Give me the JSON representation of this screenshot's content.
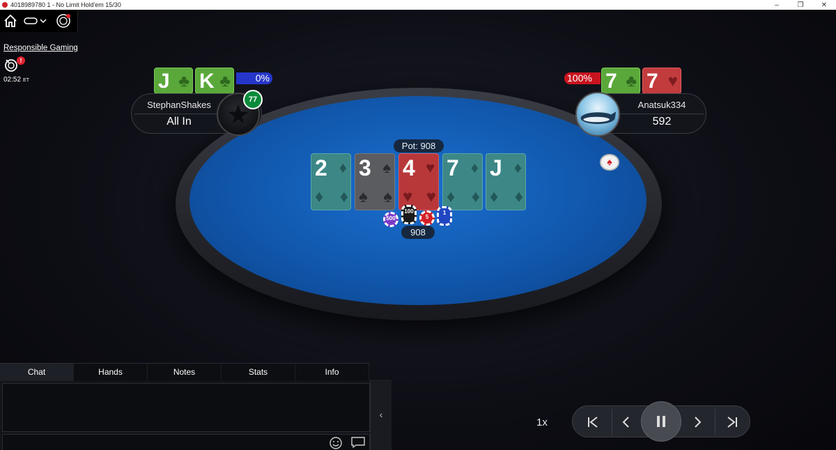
{
  "window": {
    "title": "4018989780 1 - No Limit Hold'em 15/30",
    "minimize": "–",
    "restore": "❐",
    "close": "✕"
  },
  "sidebar": {
    "responsible_gaming": "Responsible Gaming",
    "alert": "!",
    "clock": "02:52",
    "timezone": "ET"
  },
  "table": {
    "pot_label": "Pot: 908",
    "pot_amount": "908",
    "board": [
      {
        "rank": "2",
        "suit": "♦",
        "color": "teal"
      },
      {
        "rank": "3",
        "suit": "♠",
        "color": "gray"
      },
      {
        "rank": "4",
        "suit": "♥",
        "color": "red"
      },
      {
        "rank": "7",
        "suit": "♦",
        "color": "teal"
      },
      {
        "rank": "J",
        "suit": "♦",
        "color": "teal"
      }
    ],
    "chips": [
      "500",
      "100",
      "5",
      "1"
    ]
  },
  "players": {
    "left": {
      "name": "StephanShakes",
      "status": "All In",
      "equity": "0%",
      "hand_badge": "77",
      "cards": [
        {
          "rank": "J",
          "suit": "♣"
        },
        {
          "rank": "K",
          "suit": "♣"
        }
      ]
    },
    "right": {
      "name": "Anatsuk334",
      "stack": "592",
      "equity": "100%",
      "cards": [
        {
          "rank": "7",
          "suit": "♣"
        },
        {
          "rank": "7",
          "suit": "♥"
        }
      ]
    }
  },
  "chat": {
    "tabs": [
      "Chat",
      "Hands",
      "Notes",
      "Stats",
      "Info"
    ],
    "active_tab": "Chat",
    "collapse": "‹"
  },
  "replay": {
    "speed": "1x"
  },
  "colors": {
    "felt": "#1157ac",
    "equity_left": "#2536c9",
    "equity_right": "#c8141f",
    "card_green": "#5aa83a",
    "card_red": "#c23b3d"
  }
}
